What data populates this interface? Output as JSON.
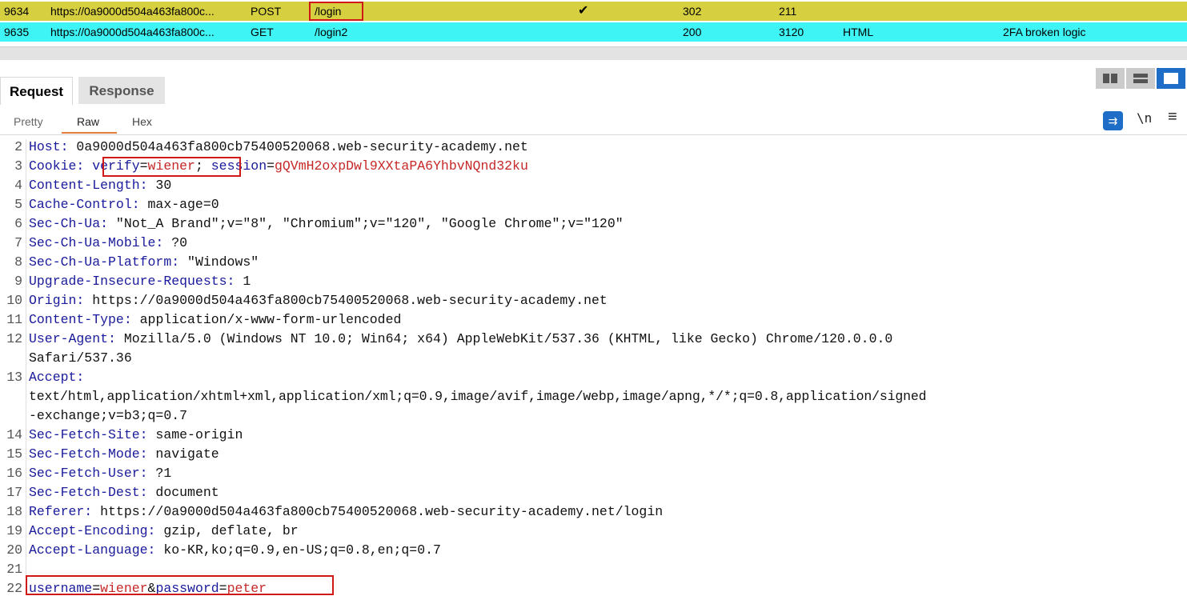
{
  "history": [
    {
      "id": "9634",
      "url": "https://0a9000d504a463fa800c...",
      "method": "POST",
      "path": "/login",
      "edited": "✔",
      "status": "302",
      "length": "211",
      "mime": "",
      "title": ""
    },
    {
      "id": "9635",
      "url": "https://0a9000d504a463fa800c...",
      "method": "GET",
      "path": "/login2",
      "edited": "",
      "status": "200",
      "length": "3120",
      "mime": "HTML",
      "title": "2FA broken logic"
    }
  ],
  "tabs": {
    "request": "Request",
    "response": "Response"
  },
  "subtabs": {
    "pretty": "Pretty",
    "raw": "Raw",
    "hex": "Hex"
  },
  "toolbar": {
    "newline_label": "\\n",
    "menu_glyph": "≡",
    "wrap_glyph": "⇉"
  },
  "request": {
    "l2": {
      "num": "2",
      "k": "Host:",
      "v": " 0a9000d504a463fa800cb75400520068.web-security-academy.net"
    },
    "l3": {
      "num": "3",
      "k": "Cookie:",
      "v_sp": " ",
      "ck1": "verify",
      "eq1": "=",
      "cv1": "wiener",
      "sep": "; ",
      "ck2": "session",
      "eq2": "=",
      "cv2": "gQVmH2oxpDwl9XXtaPA6YhbvNQnd32ku"
    },
    "l4": {
      "num": "4",
      "k": "Content-Length:",
      "v": " 30"
    },
    "l5": {
      "num": "5",
      "k": "Cache-Control:",
      "v": " max-age=0"
    },
    "l6": {
      "num": "6",
      "k": "Sec-Ch-Ua:",
      "v": " \"Not_A Brand\";v=\"8\", \"Chromium\";v=\"120\", \"Google Chrome\";v=\"120\""
    },
    "l7": {
      "num": "7",
      "k": "Sec-Ch-Ua-Mobile:",
      "v": " ?0"
    },
    "l8": {
      "num": "8",
      "k": "Sec-Ch-Ua-Platform:",
      "v": " \"Windows\""
    },
    "l9": {
      "num": "9",
      "k": "Upgrade-Insecure-Requests:",
      "v": " 1"
    },
    "l10": {
      "num": "10",
      "k": "Origin:",
      "v": " https://0a9000d504a463fa800cb75400520068.web-security-academy.net"
    },
    "l11": {
      "num": "11",
      "k": "Content-Type:",
      "v": " application/x-www-form-urlencoded"
    },
    "l12": {
      "num": "12",
      "k": "User-Agent:",
      "v": " Mozilla/5.0 (Windows NT 10.0; Win64; x64) AppleWebKit/537.36 (KHTML, like Gecko) Chrome/120.0.0.0",
      "v2": "Safari/537.36"
    },
    "l13": {
      "num": "13",
      "k": "Accept:",
      "v": "text/html,application/xhtml+xml,application/xml;q=0.9,image/avif,image/webp,image/apng,*/*;q=0.8,application/signed",
      "v2": "-exchange;v=b3;q=0.7"
    },
    "l14": {
      "num": "14",
      "k": "Sec-Fetch-Site:",
      "v": " same-origin"
    },
    "l15": {
      "num": "15",
      "k": "Sec-Fetch-Mode:",
      "v": " navigate"
    },
    "l16": {
      "num": "16",
      "k": "Sec-Fetch-User:",
      "v": " ?1"
    },
    "l17": {
      "num": "17",
      "k": "Sec-Fetch-Dest:",
      "v": " document"
    },
    "l18": {
      "num": "18",
      "k": "Referer:",
      "v": " https://0a9000d504a463fa800cb75400520068.web-security-academy.net/login"
    },
    "l19": {
      "num": "19",
      "k": "Accept-Encoding:",
      "v": " gzip, deflate, br"
    },
    "l20": {
      "num": "20",
      "k": "Accept-Language:",
      "v": " ko-KR,ko;q=0.9,en-US;q=0.8,en;q=0.7"
    },
    "l21": {
      "num": "21"
    },
    "l22": {
      "num": "22",
      "p1": "username",
      "e1": "=",
      "v1": "wiener",
      "amp": "&",
      "p2": "password",
      "e2": "=",
      "v2": "peter"
    }
  },
  "colors": {
    "row_selected": "#d6cf40",
    "row_highlight": "#3ff4f4",
    "header_key": "#1a1a9c",
    "cookie_value": "#c62828",
    "accent": "#1e6ec8",
    "annotation": "#d01818"
  }
}
